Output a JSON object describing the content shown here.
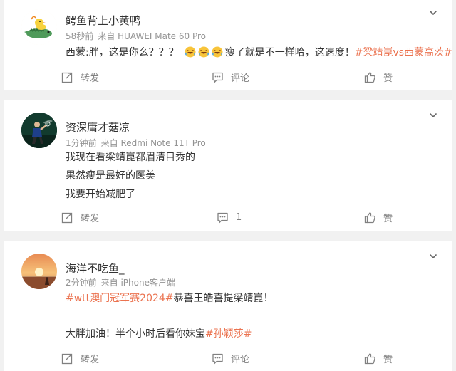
{
  "posts": [
    {
      "username": "鳄鱼背上小黄鸭",
      "time": "58秒前",
      "source": "来自 HUAWEI Mate 60 Pro",
      "text": {
        "pre": "西蒙:胖，这是你么？？？",
        "mid": "瘦了就是不一样哈，这速度！",
        "topic": "#梁靖崑vs西蒙高茨#"
      },
      "actions": {
        "repost": "转发",
        "comment": "评论",
        "like": "赞"
      }
    },
    {
      "username": "资深庸才菇凉",
      "time": "1分钟前",
      "source": "来自 Redmi Note 11T Pro",
      "lines": [
        "我现在看梁靖崑都眉清目秀的",
        "果然瘦是最好的医美",
        "我要开始减肥了"
      ],
      "actions": {
        "repost": "转发",
        "comment": "1",
        "like": "赞"
      }
    },
    {
      "username": "海洋不吃鱼_",
      "time": "2分钟前",
      "source": "来自 iPhone客户端",
      "line1": {
        "topic": "#wtt澳门冠军赛2024#",
        "text": "恭喜王皓喜提梁靖崑！"
      },
      "line2": {
        "text": "大胖加油！半个小时后看你妹宝",
        "topic": "#孙颖莎#"
      },
      "actions": {
        "repost": "转发",
        "comment": "评论",
        "like": "赞"
      }
    }
  ],
  "colors": {
    "topic": "#eb7350",
    "meta": "#939393",
    "background": "#f1f1f1"
  },
  "icons": [
    "crocodile-duck-avatar",
    "badminton-player-avatar",
    "sunset-avatar",
    "chevron-down-icon",
    "repost-icon",
    "comment-icon",
    "like-icon",
    "laugh-cry-emoji"
  ]
}
